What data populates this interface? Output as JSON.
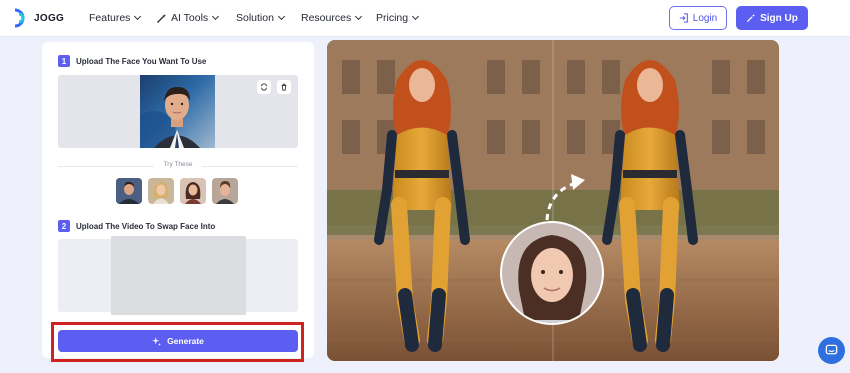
{
  "brand": {
    "name": "JOGG"
  },
  "nav": {
    "menu": [
      {
        "label": "Features"
      },
      {
        "label": "AI Tools"
      },
      {
        "label": "Solution"
      },
      {
        "label": "Resources"
      },
      {
        "label": "Pricing"
      }
    ],
    "login_label": "Login",
    "signup_label": "Sign Up"
  },
  "panel": {
    "step1": {
      "number": "1",
      "label": "Upload The Face You Want To Use"
    },
    "try_these": "Try These",
    "samples": [
      "sample-face-man",
      "sample-face-woman-blonde",
      "sample-face-woman-dark",
      "sample-face-man-young"
    ],
    "step2": {
      "number": "2",
      "label": "Upload The Video To Swap Face Into"
    },
    "generate_label": "Generate"
  },
  "colors": {
    "accent": "#5b5ef0",
    "highlight_border": "#d0221f",
    "chat_button": "#2f6fe0"
  },
  "icons": {
    "replace": "swap-icon",
    "delete": "trash-icon",
    "generate": "sparkle-icon",
    "login": "login-icon",
    "signup": "sparkle-icon",
    "chat": "chat-icon"
  }
}
